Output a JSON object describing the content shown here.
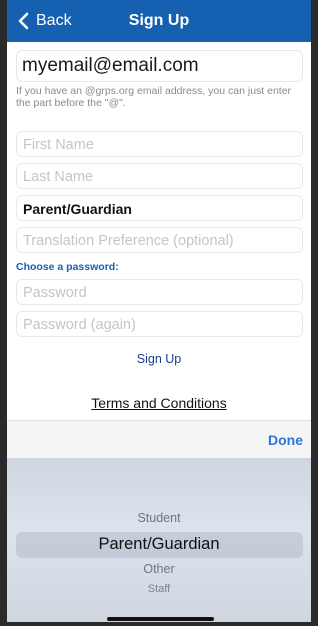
{
  "nav": {
    "back_label": "Back",
    "title": "Sign Up"
  },
  "email": {
    "value": "myemail@email.com",
    "hint": "If you have an @grps.org email address, you can just enter the part before the \"@\"."
  },
  "fields": {
    "first_name_placeholder": "First Name",
    "last_name_placeholder": "Last Name",
    "role_value": "Parent/Guardian",
    "translation_placeholder": "Translation Preference (optional)",
    "password_label": "Choose a password:",
    "password_placeholder": "Password",
    "password_again_placeholder": "Password (again)"
  },
  "actions": {
    "signup_label": "Sign Up",
    "terms_label": "Terms and Conditions",
    "done_label": "Done"
  },
  "picker": {
    "options": [
      "Student",
      "Parent/Guardian",
      "Other",
      "Staff"
    ],
    "selected": "Parent/Guardian"
  },
  "colors": {
    "accent": "#1560b0",
    "done": "#2a78d6"
  }
}
